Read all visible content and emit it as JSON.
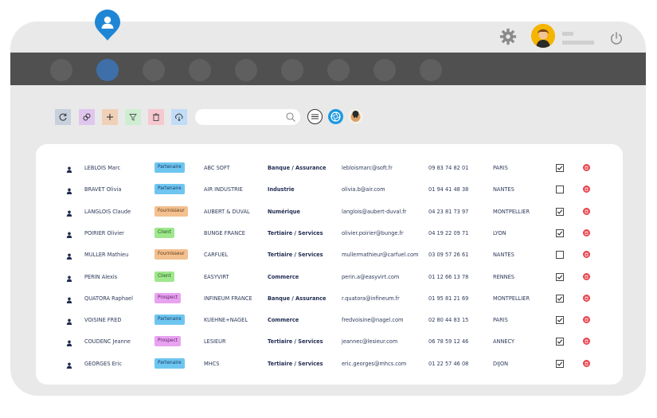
{
  "header": {
    "nav_count": 9,
    "active_nav": 1,
    "colors": {
      "frame": "#e9e9e9",
      "navbar": "#505050",
      "active": "#3f6fa9"
    }
  },
  "toolbar": {
    "buttons": [
      {
        "icon": "refresh-icon",
        "color": "#c7d0dd"
      },
      {
        "icon": "link-icon",
        "color": "#e0c6ee"
      },
      {
        "icon": "plus-icon",
        "color": "#f0d1b8"
      },
      {
        "icon": "filter-icon",
        "color": "#cdeed0"
      },
      {
        "icon": "trash-icon",
        "color": "#f6c8cf"
      },
      {
        "icon": "cloud-download-icon",
        "color": "#c1dcf6"
      }
    ],
    "search_placeholder": ""
  },
  "contacts": [
    {
      "name": "LEBLOIS Marc",
      "type": "Partenaire",
      "company": "ABC SOFT",
      "sector": "Banque / Assurance",
      "email": "lebloismarc@soft.fr",
      "phone": "09 83 74 82 01",
      "city": "PARIS",
      "checked": true
    },
    {
      "name": "BRAVET Olivia",
      "type": "Partenaire",
      "company": "AIR INDUSTRIE",
      "sector": "Industrie",
      "email": "olivia.b@air.com",
      "phone": "01 94 41 48 38",
      "city": "NANTES",
      "checked": false
    },
    {
      "name": "LANGLOIS Claude",
      "type": "Fournisseur",
      "company": "AUBERT & DUVAL",
      "sector": "Numérique",
      "email": "langlois@aubert-duval.fr",
      "phone": "04 23 81 73 97",
      "city": "MONTPELLIER",
      "checked": true
    },
    {
      "name": "POIRIER Olivier",
      "type": "Client",
      "company": "BUNGE FRANCE",
      "sector": "Tertiaire / Services",
      "email": "olivier.poirier@bunge.fr",
      "phone": "04 19 22 09 71",
      "city": "LYON",
      "checked": true
    },
    {
      "name": "MULLER Mathieu",
      "type": "Fournisseur",
      "company": "CARFUEL",
      "sector": "Tertiaire / Services",
      "email": "mullermathieur@carfuel.com",
      "phone": "03 09 57 26 61",
      "city": "NANTES",
      "checked": false
    },
    {
      "name": "PERIN Alexis",
      "type": "Client",
      "company": "EASYVIRT",
      "sector": "Commerce",
      "email": "perin.a@easyvirt.com",
      "phone": "01 12 66 13 78",
      "city": "RENNES",
      "checked": true
    },
    {
      "name": "QUATORA Raphael",
      "type": "Prospect",
      "company": "INFINEUM FRANCE",
      "sector": "Banque / Assurance",
      "email": "r.quatora@infineum.fr",
      "phone": "01 95 81 21 69",
      "city": "MONTPELLIER",
      "checked": true
    },
    {
      "name": "VOISINE FRED",
      "type": "Partenaire",
      "company": "KUEHNE+NAGEL",
      "sector": "Commerce",
      "email": "fredvoisine@nagel.com",
      "phone": "02 80 44 83 15",
      "city": "PARIS",
      "checked": true
    },
    {
      "name": "COUDENC Jeanne",
      "type": "Prospect",
      "company": "LESIEUR",
      "sector": "Tertiaire / Services",
      "email": "jeannec@lesieur.com",
      "phone": "06 78 59 12 46",
      "city": "ANNECY",
      "checked": true
    },
    {
      "name": "GEORGES Eric",
      "type": "Partenaire",
      "company": "MHCS",
      "sector": "Tertiaire / Services",
      "email": "eric.georges@mhcs.com",
      "phone": "01 22 57 46 08",
      "city": "DIJON",
      "checked": true
    }
  ]
}
